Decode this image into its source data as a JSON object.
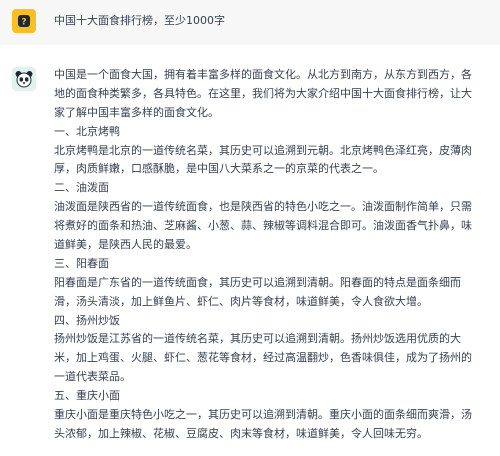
{
  "user": {
    "avatar_icon": "user-avatar-icon",
    "prompt": "中国十大面食排行榜，至少1000字"
  },
  "assistant": {
    "avatar_icon": "chatbot-panda-icon",
    "lines": [
      "中国是一个面食大国，拥有着丰富多样的面食文化。从北方到南方，从东方到西方，各",
      "地的面食种类繁多，各具特色。在这里，我们将为大家介绍中国十大面食排行榜，让大",
      "家了解中国丰富多样的面食文化。",
      "一、北京烤鸭",
      "北京烤鸭是北京的一道传统名菜，其历史可以追溯到元朝。北京烤鸭色泽红亮，皮薄肉",
      "厚，肉质鲜嫩，口感酥脆，是中国八大菜系之一的京菜的代表之一。",
      "二、油泼面",
      "油泼面是陕西省的一道传统面食，也是陕西省的特色小吃之一。油泼面制作简单，只需",
      "将煮好的面条和热油、芝麻酱、小葱、蒜、辣椒等调料混合即可。油泼面香气扑鼻，味",
      "道鲜美，是陕西人民的最爱。",
      "三、阳春面",
      "阳春面是广东省的一道传统面食，其历史可以追溯到清朝。阳春面的特点是面条细而",
      "滑，汤头清淡，加上鲜鱼片、虾仁、肉片等食材，味道鲜美，令人食欲大增。",
      "四、扬州炒饭",
      "扬州炒饭是江苏省的一道传统名菜，其历史可以追溯到清朝。扬州炒饭选用优质的大",
      "米，加上鸡蛋、火腿、虾仁、葱花等食材，经过高温翻炒，色香味俱佳，成为了扬州的",
      "一道代表菜品。",
      "五、重庆小面",
      "重庆小面是重庆特色小吃之一，其历史可以追溯到清朝。重庆小面的面条细而爽滑，汤",
      "头浓郁，加上辣椒、花椒、豆腐皮、肉末等食材，味道鲜美，令人回味无穷。"
    ]
  }
}
